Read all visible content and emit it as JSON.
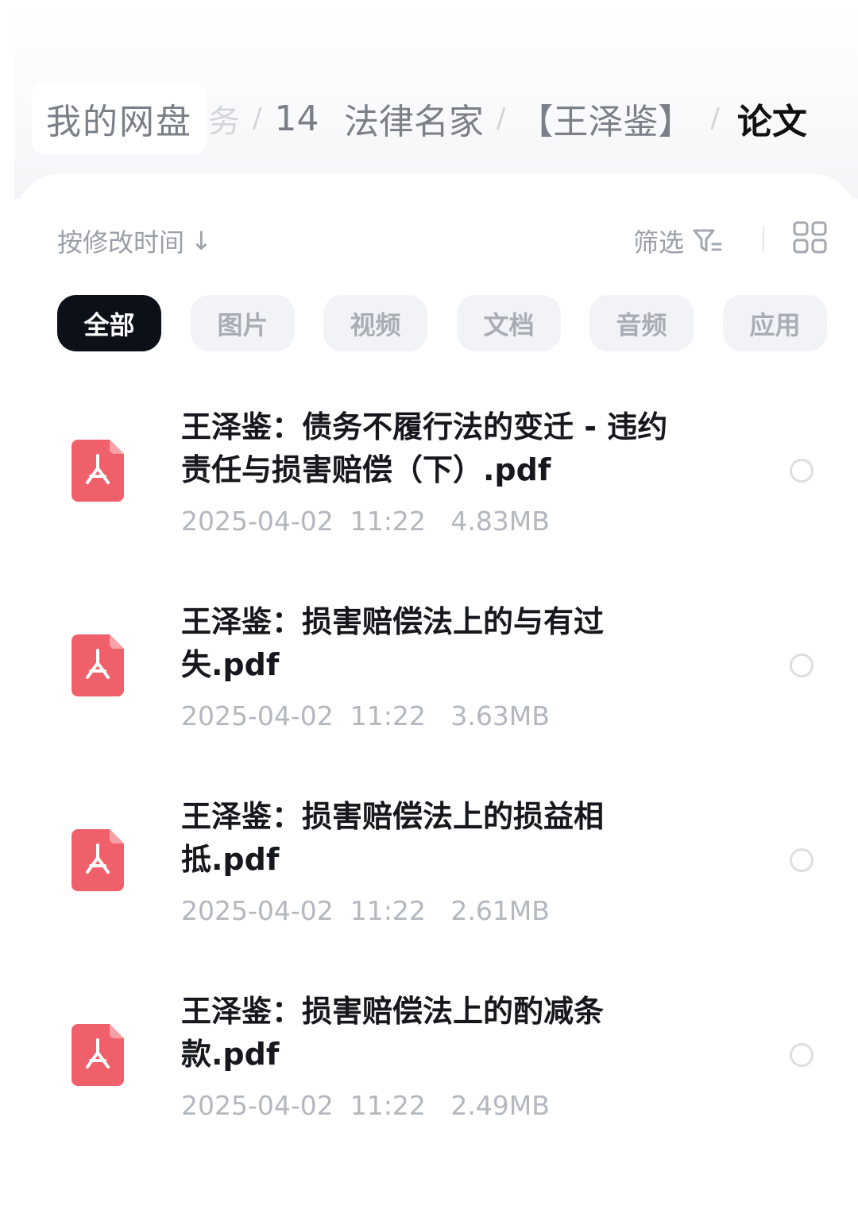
{
  "breadcrumb": {
    "root": "我的网盘",
    "partial": "务",
    "separator": "/",
    "items": [
      "14",
      "法律名家",
      "【王泽鉴】"
    ],
    "current": "论文"
  },
  "toolbar": {
    "sort_label": "按修改时间",
    "sort_arrow": "↓",
    "filter_label": "筛选",
    "filter_icon": "filter-icon",
    "view_icon": "grid-view-icon"
  },
  "tabs": [
    {
      "label": "全部",
      "active": true
    },
    {
      "label": "图片",
      "active": false
    },
    {
      "label": "视频",
      "active": false
    },
    {
      "label": "文档",
      "active": false
    },
    {
      "label": "音频",
      "active": false
    },
    {
      "label": "应用",
      "active": false
    }
  ],
  "files": [
    {
      "name_line1": "王泽鉴：债务不履行法的变迁 - 违约",
      "name_line2": "责任与损害赔偿（下）.pdf",
      "meta": "2025-04-02  11:22   4.83MB",
      "icon": "pdf-icon"
    },
    {
      "name_line1": "王泽鉴：损害赔偿法上的与有过",
      "name_line2": "失.pdf",
      "meta": "2025-04-02  11:22   3.63MB",
      "icon": "pdf-icon"
    },
    {
      "name_line1": "王泽鉴：损害赔偿法上的损益相",
      "name_line2": "抵.pdf",
      "meta": "2025-04-02  11:22   2.61MB",
      "icon": "pdf-icon"
    },
    {
      "name_line1": "王泽鉴：损害赔偿法上的酌减条",
      "name_line2": "款.pdf",
      "meta": "2025-04-02  11:22   2.49MB",
      "icon": "pdf-icon"
    }
  ],
  "colors": {
    "pdf_red": "#f0606a",
    "active_tab_bg": "#0c1019",
    "text_primary": "#16181d",
    "text_muted": "#b3b7be"
  }
}
